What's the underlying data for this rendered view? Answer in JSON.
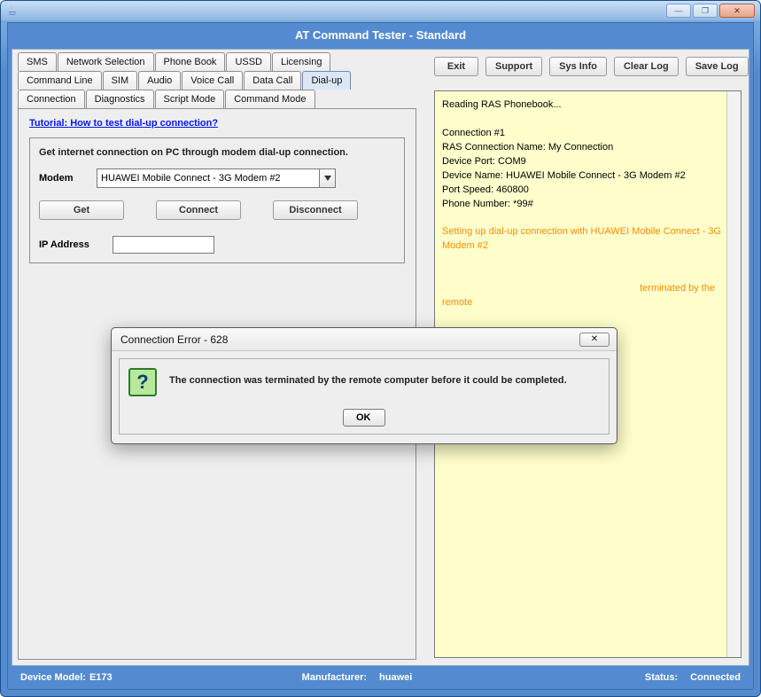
{
  "window": {
    "minimize": "—",
    "maximize": "❐",
    "close": "✕"
  },
  "app_title": "AT Command Tester - Standard",
  "top_buttons": [
    "Exit",
    "Support",
    "Sys Info",
    "Clear Log",
    "Save Log"
  ],
  "tabs": {
    "row1": [
      "SMS",
      "Network Selection",
      "Phone Book",
      "USSD",
      "Licensing"
    ],
    "row2": [
      "Command Line",
      "SIM",
      "Audio",
      "Voice Call",
      "Data Call",
      "Dial-up"
    ],
    "row3": [
      "Connection",
      "Diagnostics",
      "Script Mode",
      "Command Mode"
    ],
    "active": "Dial-up"
  },
  "tutorial_link": "Tutorial: How to test dial-up connection?",
  "panel": {
    "heading": "Get internet connection on PC through modem dial-up connection.",
    "modem_label": "Modem",
    "modem_value": "HUAWEI Mobile Connect - 3G Modem #2",
    "buttons": {
      "get": "Get",
      "connect": "Connect",
      "disconnect": "Disconnect"
    },
    "ip_label": "IP Address",
    "ip_value": ""
  },
  "log": {
    "block1": "Reading RAS Phonebook...\n\nConnection #1\nRAS Connection Name: My Connection\nDevice Port: COM9\nDevice Name: HUAWEI Mobile Connect - 3G Modem #2\nPort Speed: 460800\nPhone Number: *99#\n",
    "block2": "Setting up dial-up connection with HUAWEI Mobile Connect - 3G Modem #2\n",
    "block3": "                                                                         terminated by the remote"
  },
  "modal": {
    "title": "Connection Error - 628",
    "icon": "?",
    "message": "The connection was terminated by the remote computer before it could be completed.",
    "ok": "OK",
    "close": "✕"
  },
  "statusbar": {
    "model_label": "Device Model:",
    "model_value": "E173",
    "mfr_label": "Manufacturer:",
    "mfr_value": "huawei",
    "status_label": "Status:",
    "status_value": "Connected"
  }
}
